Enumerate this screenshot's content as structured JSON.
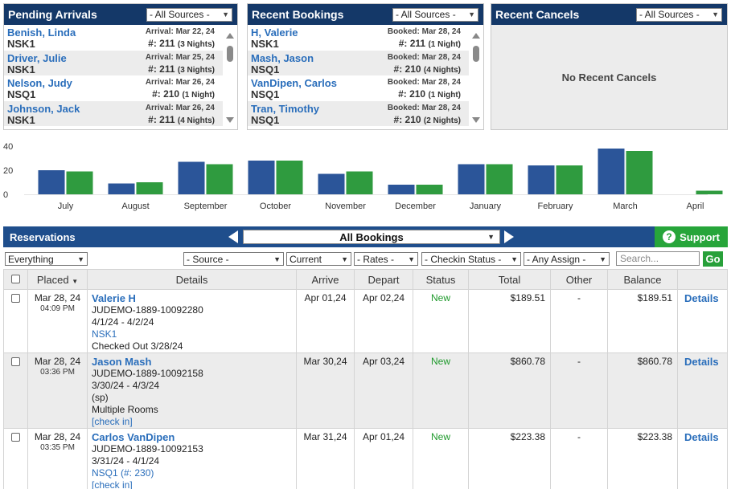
{
  "panels": {
    "arrivals": {
      "title": "Pending Arrivals",
      "source_select": "- All Sources -",
      "items": [
        {
          "name": "Benish, Linda",
          "unit": "NSK1",
          "date": "Arrival: Mar 22, 24",
          "room": "#: 211",
          "nights": "(3 Nights)"
        },
        {
          "name": "Driver, Julie",
          "unit": "NSK1",
          "date": "Arrival: Mar 25, 24",
          "room": "#: 211",
          "nights": "(3 Nights)"
        },
        {
          "name": "Nelson, Judy",
          "unit": "NSQ1",
          "date": "Arrival: Mar 26, 24",
          "room": "#: 210",
          "nights": "(1 Night)"
        },
        {
          "name": "Johnson, Jack",
          "unit": "NSK1",
          "date": "Arrival: Mar 26, 24",
          "room": "#: 211",
          "nights": "(4 Nights)"
        }
      ]
    },
    "bookings": {
      "title": "Recent Bookings",
      "source_select": "- All Sources -",
      "items": [
        {
          "name": "H, Valerie",
          "unit": "NSK1",
          "date": "Booked: Mar 28, 24",
          "room": "#: 211",
          "nights": "(1 Night)"
        },
        {
          "name": "Mash, Jason",
          "unit": "NSQ1",
          "date": "Booked: Mar 28, 24",
          "room": "#: 210",
          "nights": "(4 Nights)"
        },
        {
          "name": "VanDipen, Carlos",
          "unit": "NSQ1",
          "date": "Booked: Mar 28, 24",
          "room": "#: 210",
          "nights": "(1 Night)"
        },
        {
          "name": "Tran, Timothy",
          "unit": "NSQ1",
          "date": "Booked: Mar 28, 24",
          "room": "#: 210",
          "nights": "(2 Nights)"
        }
      ]
    },
    "cancels": {
      "title": "Recent Cancels",
      "source_select": "- All Sources -",
      "empty_text": "No Recent Cancels"
    }
  },
  "chart_data": {
    "type": "bar",
    "categories": [
      "July",
      "August",
      "September",
      "October",
      "November",
      "December",
      "January",
      "February",
      "March",
      "April"
    ],
    "series": [
      {
        "values": [
          20,
          9,
          27,
          28,
          17,
          8,
          25,
          24,
          38,
          0
        ]
      },
      {
        "values": [
          19,
          10,
          25,
          28,
          19,
          8,
          25,
          24,
          36,
          3
        ]
      }
    ],
    "colors": [
      "#2b5599",
      "#2f9b3f"
    ],
    "ylim": [
      0,
      40
    ],
    "yticks": [
      0,
      20,
      40
    ]
  },
  "reservations": {
    "title": "Reservations",
    "view_select": "All Bookings",
    "support_label": "Support",
    "filters": {
      "type": "Everything",
      "source": "- Source -",
      "period": "Current",
      "rates": "- Rates -",
      "checkin": "- Checkin Status -",
      "assign": "- Any Assign -",
      "search_placeholder": "Search...",
      "go_label": "Go"
    },
    "columns": [
      "Placed",
      "Details",
      "Arrive",
      "Depart",
      "Status",
      "Total",
      "Other",
      "Balance"
    ],
    "rows": [
      {
        "placed_date": "Mar 28, 24",
        "placed_time": "04:09 PM",
        "name": "Valerie H",
        "code": "JUDEMO-1889-10092280",
        "range": "4/1/24 - 4/2/24",
        "unit": "NSK1",
        "note": "Checked Out 3/28/24",
        "arrive": "Apr 01,24",
        "depart": "Apr 02,24",
        "status": "New",
        "total": "$189.51",
        "other": "-",
        "balance": "$189.51",
        "action": "Details"
      },
      {
        "placed_date": "Mar 28, 24",
        "placed_time": "03:36 PM",
        "name": "Jason Mash",
        "code": "JUDEMO-1889-10092158",
        "range": "3/30/24 - 4/3/24",
        "extra": "(sp)",
        "note": "Multiple Rooms",
        "checkin": "[check in]",
        "arrive": "Mar 30,24",
        "depart": "Apr 03,24",
        "status": "New",
        "total": "$860.78",
        "other": "-",
        "balance": "$860.78",
        "action": "Details"
      },
      {
        "placed_date": "Mar 28, 24",
        "placed_time": "03:35 PM",
        "name": "Carlos VanDipen",
        "code": "JUDEMO-1889-10092153",
        "range": "3/31/24 - 4/1/24",
        "unit": "NSQ1 (#: 230)",
        "checkin": "[check in]",
        "arrive": "Mar 31,24",
        "depart": "Apr 01,24",
        "status": "New",
        "total": "$223.38",
        "other": "-",
        "balance": "$223.38",
        "action": "Details"
      }
    ]
  }
}
